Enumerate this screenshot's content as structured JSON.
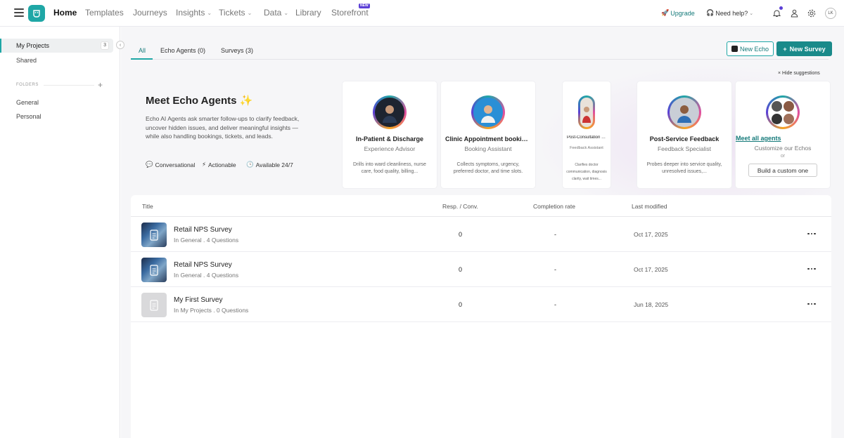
{
  "nav": {
    "home": "Home",
    "templates": "Templates",
    "journeys": "Journeys",
    "insights": "Insights",
    "tickets": "Tickets",
    "data": "Data",
    "library": "Library",
    "storefront": "Storefront",
    "new_badge": "NEW",
    "upgrade": "Upgrade",
    "help": "Need help?",
    "avatar": "LK",
    "brand_color": "#1fa7a6",
    "accent_color": "#5b3fd6"
  },
  "sidebar": {
    "items": [
      {
        "label": "My Projects",
        "count": "3"
      },
      {
        "label": "Shared"
      }
    ],
    "folders_label": "FOLDERS",
    "folders": [
      {
        "label": "General"
      },
      {
        "label": "Personal"
      }
    ]
  },
  "tabs": [
    {
      "label": "All"
    },
    {
      "label": "Echo Agents (0)"
    },
    {
      "label": "Surveys (3)"
    }
  ],
  "actions": {
    "new_echo": "New Echo",
    "new_survey": "New Survey"
  },
  "suggestions": {
    "hide_label": "Hide suggestions",
    "title": "Meet Echo Agents ✨",
    "description": "Echo AI Agents ask smarter follow-ups to clarify feedback, uncover hidden issues, and deliver meaningful insights — while also handling bookings, tickets, and leads.",
    "features": [
      "Conversational",
      "Actionable",
      "Available 24/7"
    ],
    "cards": [
      {
        "name": "In-Patient & Discharge",
        "role": "Experience Advisor",
        "description": "Drills into ward cleanliness, nurse care, food quality, billing..."
      },
      {
        "name": "Clinic Appointment bookings",
        "role": "Booking Assistant",
        "description": "Collects symptoms, urgency, preferred doctor, and time slots."
      },
      {
        "name": "Post-Consultation Feedback",
        "role": "Feedback Assistant",
        "description": "Clarifies doctor communication, diagnosis clarity, wait times..."
      },
      {
        "name": "Post-Service Feedback",
        "role": "Feedback Specialist",
        "description": "Probes deeper into service quality, unresolved issues,..."
      }
    ],
    "meet_all": "Meet all agents",
    "customize": "Customize our Echos",
    "or": "or",
    "build": "Build a custom one"
  },
  "table": {
    "columns": [
      "Title",
      "Resp. / Conv.",
      "Completion rate",
      "Last modified"
    ],
    "rows": [
      {
        "title": "Retail NPS Survey",
        "subtitle": "In General . 4 Questions",
        "responses": "0",
        "completion": "-",
        "modified": "Oct 17, 2025"
      },
      {
        "title": "Retail NPS Survey",
        "subtitle": "In General . 4 Questions",
        "responses": "0",
        "completion": "-",
        "modified": "Oct 17, 2025"
      },
      {
        "title": "My First Survey",
        "subtitle": "In My Projects . 0 Questions",
        "responses": "0",
        "completion": "-",
        "modified": "Jun 18, 2025"
      }
    ]
  }
}
